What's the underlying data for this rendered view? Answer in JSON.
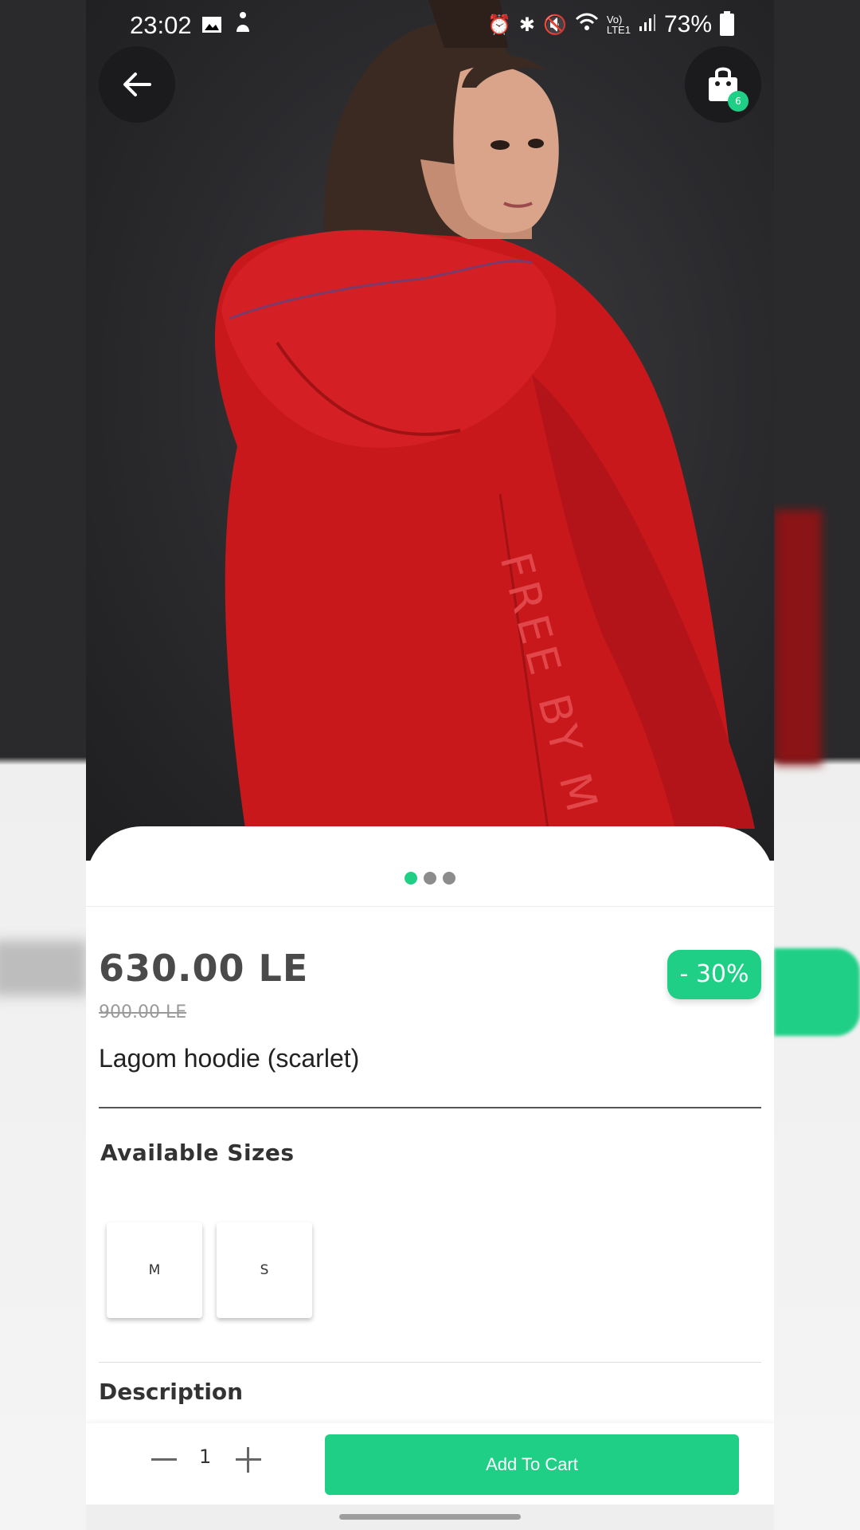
{
  "status_bar": {
    "time": "23:02",
    "battery": "73%",
    "icons": [
      "gallery-icon",
      "accessibility-icon",
      "alarm-icon",
      "bluetooth-icon",
      "mute-icon",
      "wifi-icon",
      "volte-icon",
      "signal-icon",
      "battery-icon"
    ]
  },
  "header": {
    "back_icon": "arrow-left-icon",
    "cart_icon": "shopping-bag-icon",
    "cart_count": "6"
  },
  "gallery": {
    "image": "red-hoodie-model-photo",
    "embroidery_text": "FREE BY M",
    "total_images": 3,
    "active_index": 0
  },
  "product": {
    "price": "630.00 LE",
    "old_price": "900.00 LE",
    "discount": "- 30%",
    "name": "Lagom hoodie (scarlet)"
  },
  "sizes": {
    "title": "Available Sizes",
    "options": [
      "M",
      "S"
    ]
  },
  "description": {
    "title": "Description"
  },
  "cart_bar": {
    "quantity": "1",
    "minus_icon": "minus-icon",
    "plus_icon": "plus-icon",
    "add_label": "Add To Cart"
  },
  "colors": {
    "accent": "#1fcf86",
    "hoodie_red": "#c8181b",
    "hero_bg": "#2a2a2d"
  }
}
